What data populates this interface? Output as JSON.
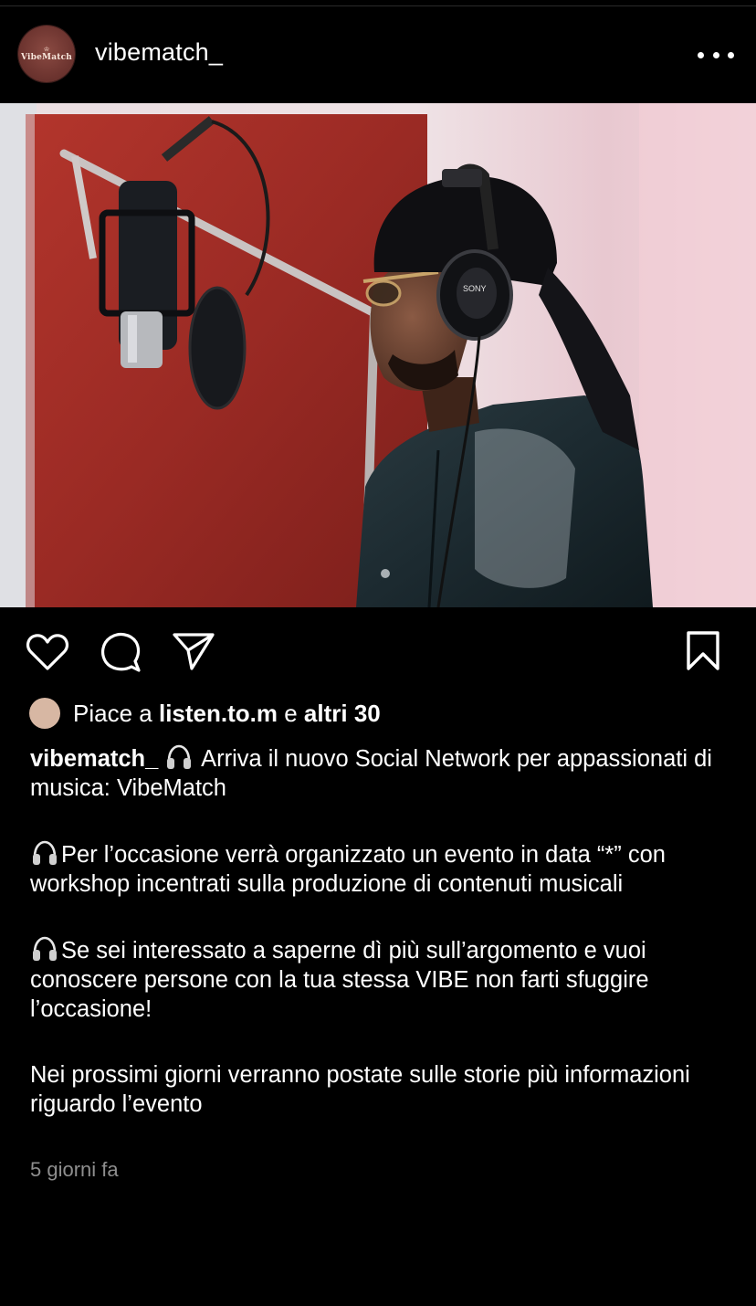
{
  "post": {
    "username": "vibematch_",
    "avatar": {
      "brand_text": "VibeMatch",
      "color": "#6e3530"
    },
    "likes": {
      "prefix": "Piace a",
      "user": "listen.to.m",
      "connector": "e",
      "others": "altri 30"
    },
    "caption": {
      "username": "vibematch_",
      "intro": " Arriva il nuovo Social Network per appassionati di musica: VibeMatch",
      "paragraphs": [
        "Per l’occasione verrà organizzato un evento in data “*” con workshop incentrati sulla produzione di contenuti musicali",
        "Se sei interessato a saperne dì più sull’argomento e vuoi conoscere persone con la tua stessa VIBE non farti sfuggire l’occasione!",
        "Nei prossimi giorni verranno postate sulle storie più informazioni riguardo l’evento"
      ]
    },
    "timestamp": "5 giorni fa",
    "icons": {
      "more": "more-horizontal-icon",
      "like": "heart-icon",
      "comment": "comment-bubble-icon",
      "share": "paper-plane-icon",
      "save": "bookmark-icon",
      "emoji": "headphones-icon"
    },
    "colors": {
      "background": "#000000",
      "text": "#ffffff",
      "muted": "#8e8e8e",
      "studio_red": "#9a2a24"
    }
  }
}
